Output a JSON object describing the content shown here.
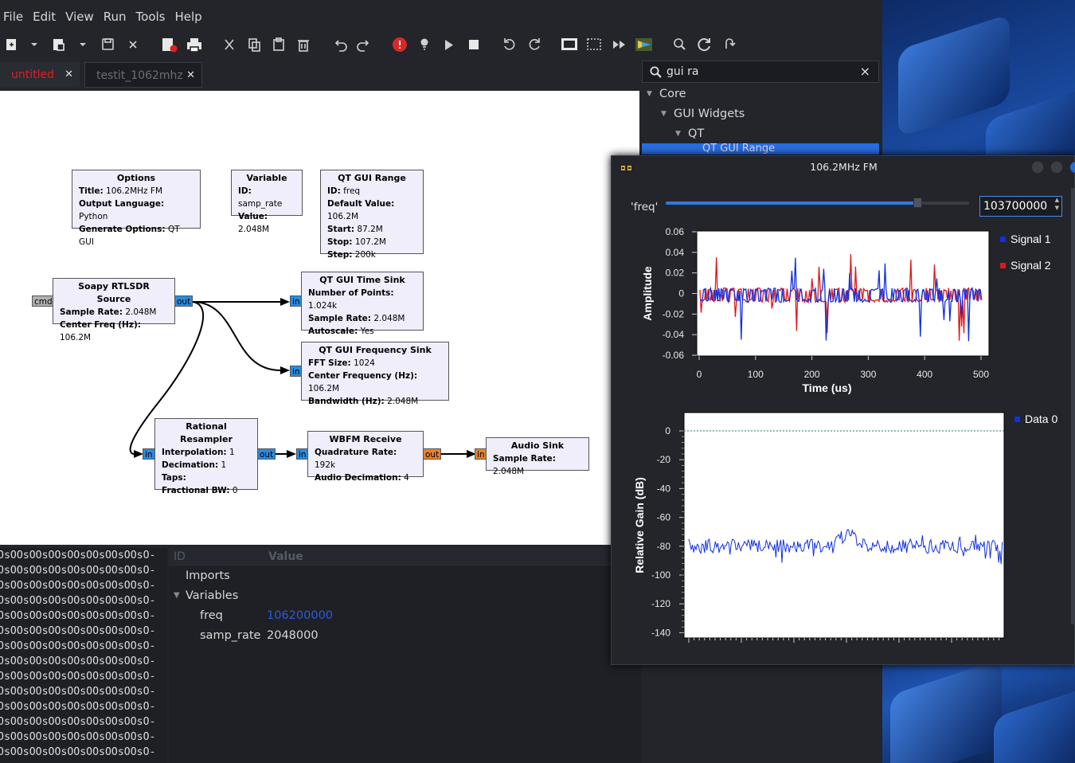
{
  "menubar": [
    "File",
    "Edit",
    "View",
    "Run",
    "Tools",
    "Help"
  ],
  "tabs": [
    {
      "label": "untitled",
      "active": true,
      "color": "#e02020"
    },
    {
      "label": "testit_1062mhz",
      "active": false
    }
  ],
  "search": {
    "value": "gui ra",
    "clear": "×"
  },
  "tree": {
    "core": "Core",
    "gui_widgets": "GUI Widgets",
    "qt": "QT",
    "selected": "QT GUI Range"
  },
  "blocks": {
    "options": {
      "title": "Options",
      "rows": [
        [
          "Title:",
          "106.2MHz FM"
        ],
        [
          "Output Language:",
          "Python"
        ],
        [
          "Generate Options:",
          "QT GUI"
        ]
      ]
    },
    "variable": {
      "title": "Variable",
      "rows": [
        [
          "ID:",
          "samp_rate"
        ],
        [
          "Value:",
          "2.048M"
        ]
      ]
    },
    "range": {
      "title": "QT GUI Range",
      "rows": [
        [
          "ID:",
          "freq"
        ],
        [
          "Default Value:",
          "106.2M"
        ],
        [
          "Start:",
          "87.2M"
        ],
        [
          "Stop:",
          "107.2M"
        ],
        [
          "Step:",
          "200k"
        ]
      ]
    },
    "soapy": {
      "title": "Soapy RTLSDR Source",
      "rows": [
        [
          "Sample Rate:",
          "2.048M"
        ],
        [
          "Center Freq (Hz):",
          "106.2M"
        ]
      ]
    },
    "timesink": {
      "title": "QT GUI Time Sink",
      "rows": [
        [
          "Number of Points:",
          "1.024k"
        ],
        [
          "Sample Rate:",
          "2.048M"
        ],
        [
          "Autoscale:",
          "Yes"
        ]
      ]
    },
    "freqsink": {
      "title": "QT GUI Frequency Sink",
      "rows": [
        [
          "FFT Size:",
          "1024"
        ],
        [
          "Center Frequency (Hz):",
          "106.2M"
        ],
        [
          "Bandwidth (Hz):",
          "2.048M"
        ]
      ]
    },
    "resampler": {
      "title": "Rational Resampler",
      "rows": [
        [
          "Interpolation:",
          "1"
        ],
        [
          "Decimation:",
          "1"
        ],
        [
          "Taps:",
          ""
        ],
        [
          "Fractional BW:",
          "0"
        ]
      ]
    },
    "wbfm": {
      "title": "WBFM Receive",
      "rows": [
        [
          "Quadrature Rate:",
          "192k"
        ],
        [
          "Audio Decimation:",
          "4"
        ]
      ]
    },
    "audiosink": {
      "title": "Audio Sink",
      "rows": [
        [
          "Sample Rate:",
          "2.048M"
        ]
      ]
    }
  },
  "ports": {
    "cmd": "cmd",
    "out": "out",
    "in": "in"
  },
  "console_line": "OsOOsOOsOOsOOsOOsOOsOOsO-",
  "vars": {
    "col_id": "ID",
    "col_value": "Value",
    "imports": "Imports",
    "variables": "Variables",
    "rows": [
      {
        "id": "freq",
        "value": "106200000",
        "color": "#2a5bd6"
      },
      {
        "id": "samp_rate",
        "value": "2048000"
      }
    ]
  },
  "qt": {
    "title": "106.2MHz FM",
    "slider_label": "'freq'",
    "slider_value": "103700000",
    "slider_fraction": 0.83,
    "time_plot": {
      "ylabel": "Amplitude",
      "xlabel": "Time (us)",
      "yticks": [
        "0.06",
        "0.04",
        "0.02",
        "0",
        "-0.02",
        "-0.04",
        "-0.06"
      ],
      "xticks": [
        "0",
        "100",
        "200",
        "300",
        "400",
        "500"
      ],
      "legend": [
        {
          "name": "Signal 1",
          "color": "#1030e0"
        },
        {
          "name": "Signal 2",
          "color": "#e01818"
        }
      ]
    },
    "freq_plot": {
      "ylabel": "Relative Gain (dB)",
      "yticks": [
        "0",
        "-20",
        "-40",
        "-60",
        "-80",
        "-100",
        "-120",
        "-140"
      ],
      "legend": [
        {
          "name": "Data 0",
          "color": "#1030e0"
        }
      ]
    }
  }
}
